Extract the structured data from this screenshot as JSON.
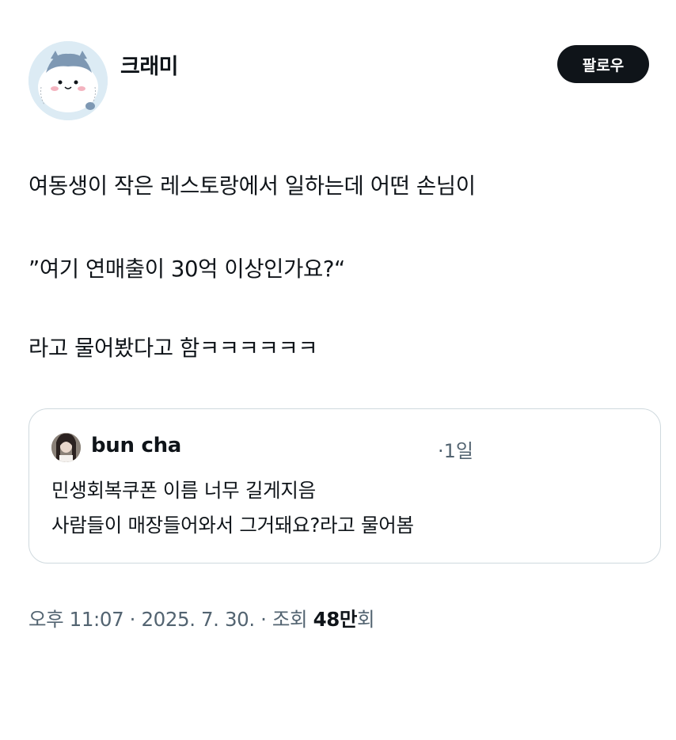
{
  "author": {
    "display_name": "크래미",
    "follow_label": "팔로우"
  },
  "tweet": {
    "lines": [
      "여동생이 작은 레스토랑에서 일하는데 어떤 손님이",
      "”여기 연매출이 30억 이상인가요?“",
      "라고 물어봤다고 함ㅋㅋㅋㅋㅋㅋ"
    ]
  },
  "quote": {
    "author_name": "bun cha",
    "time": "·1일",
    "lines": [
      "민생회복쿠폰 이름 너무 길게지음",
      "사람들이 매장들어와서 그거돼요?라고 물어봄"
    ]
  },
  "meta": {
    "time": "오후 11:07",
    "sep1": " · ",
    "date": "2025. 7. 30.",
    "sep2": " · ",
    "views_prefix": "조회 ",
    "views_count": "48만",
    "views_suffix": "회"
  },
  "colors": {
    "text": "#0f1419",
    "secondary": "#536471",
    "border": "#cfd9de",
    "follow_bg": "#0f1419",
    "avatar_bg": "#dcebf4"
  },
  "icons": {
    "author_avatar": "hamster-character-avatar",
    "quote_avatar": "person-photo-avatar"
  }
}
